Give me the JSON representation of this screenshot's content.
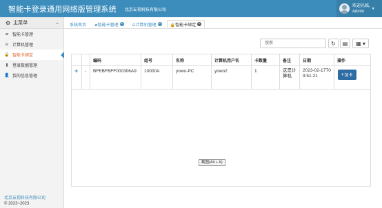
{
  "header": {
    "app_title": "智能卡登录通用网络版管理系统",
    "company": "北京友视科技有限公司",
    "welcome": "欢迎光临,",
    "username": "Admin",
    "caret": "▾"
  },
  "sidebar": {
    "title": "主菜单",
    "chevron": "⌄",
    "items": [
      {
        "icon": "▰",
        "label": "智能卡管理"
      },
      {
        "icon": "⊖",
        "label": "计算机管理"
      },
      {
        "icon": "🔒",
        "label": "智能卡绑定"
      },
      {
        "icon": "▮",
        "label": "登录数据管理"
      },
      {
        "icon": "👤",
        "label": "我的信息管理"
      }
    ],
    "footer_company": "北京友视科技有限公司",
    "footer_copy": "© 2023~2023"
  },
  "tabs": [
    {
      "label": "系统首页",
      "close": ""
    },
    {
      "label": "▰智能卡管理",
      "close": "×"
    },
    {
      "label": "⊖计算机管理",
      "close": "×"
    },
    {
      "label": "🔒智能卡绑定",
      "close": "×"
    }
  ],
  "toolbar": {
    "search_placeholder": "搜索",
    "refresh_icon": "↻",
    "columns_icon": "▤",
    "grid_icon": "▦ ▾"
  },
  "table": {
    "headers": [
      "编码",
      "组号",
      "名称",
      "计算机用户名",
      "卡数量",
      "备注",
      "日期",
      "操作"
    ],
    "rows": [
      {
        "expand": "+",
        "dash": "-",
        "code": "BFEBFBFF000306A9",
        "group": "10000A",
        "name": "yowo-PC",
        "pc_user": "yowo2",
        "card_count": "1",
        "remark": "这是计算机",
        "date": "2023-02-17T09:51:21",
        "action_plus": "+",
        "action_label": "加卡"
      }
    ]
  },
  "tooltip": "截图(Alt + A)",
  "colors": {
    "primary": "#3c8dbc",
    "active": "#e0652a",
    "button": "#2e6da4"
  }
}
